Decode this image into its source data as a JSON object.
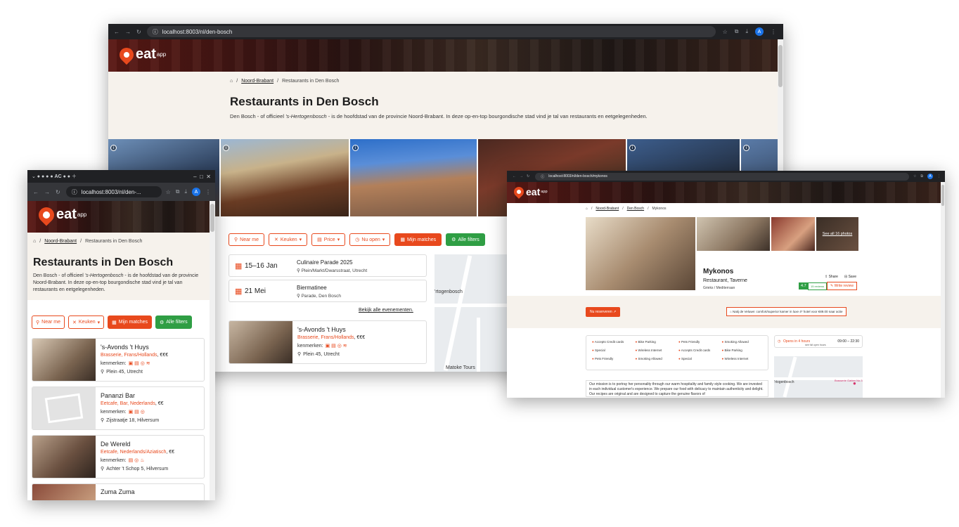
{
  "bg_window": {
    "url": "localhost:8003/nl/den-bosch",
    "logo_text": "eat",
    "logo_sub": "app",
    "breadcrumb": [
      "Noord-Brabant",
      "Restaurants in Den Bosch"
    ],
    "title": "Restaurants in Den Bosch",
    "intro_before": "Den Bosch - of officieel ",
    "intro_em": "'s-Hertogenbosch",
    "intro_after": " - is de hoofdstad van de provincie Noord-Brabant. In deze op-en-top bourgondische stad vind je tal van restaurants en eetgelegenheden.",
    "filters": {
      "near": "Near me",
      "kitchen": "Keuken",
      "price": "Price",
      "open": "Nu open",
      "matches": "Mijn matches",
      "all": "Alle filters"
    },
    "events": [
      {
        "date": "15–16 Jan",
        "name": "Culinaire Parade 2025",
        "place": "Plein/Markt/Dwarsstraat, Utrecht"
      },
      {
        "date": "21 Mei",
        "name": "Biermatinee",
        "place": "Parade, Den Bosch"
      }
    ],
    "events_link": "Bekijk alle evenementen.",
    "restaurant": {
      "name": "'s-Avonds 't Huys",
      "tags": "Brasserie, Frans/Hollands",
      "price": ", €€€",
      "features_label": "kenmerken:",
      "address": "Plein 45, Utrecht"
    },
    "map_labels": [
      "'rtogenbosch",
      "Matoke Tours"
    ]
  },
  "left_window": {
    "url": "localhost:8003/nl/den-...",
    "tab_icons": "AC",
    "logo_text": "eat",
    "logo_sub": "app",
    "breadcrumb": [
      "Noord-Brabant",
      "Restaurants in Den Bosch"
    ],
    "title": "Restaurants in Den Bosch",
    "intro_before": "Den Bosch - of officieel ",
    "intro_em": "'s-Hertogenbosch",
    "intro_after": " - is de hoofdstad van de provincie Noord-Brabant. In deze op-en-top bourgondische stad vind je tal van restaurants en eetgelegenheden.",
    "filters": {
      "near": "Near me",
      "kitchen": "Keuken",
      "matches": "Mijn matches",
      "all": "Alle filters"
    },
    "features_label": "kenmerken:",
    "restaurants": [
      {
        "name": "'s-Avonds 't Huys",
        "tags": "Brasserie, Frans/Hollands",
        "price": ", €€€",
        "address": "Plein 45, Utrecht"
      },
      {
        "name": "Pananzi Bar",
        "tags": "Eetcafe, Bar, Nederlands",
        "price": ", €€",
        "address": "Zijstraatje 18, Hilversum"
      },
      {
        "name": "De Wereld",
        "tags": "Eetcafe, Nederlands/Aziatisch",
        "price": ", €€",
        "address": "Achter 't Schop 5, Hilversum"
      },
      {
        "name": "Zuma Zuma",
        "tags": "",
        "price": "",
        "address": ""
      }
    ]
  },
  "right_window": {
    "url": "localhost:8003/nl/den-bosch/mykonos",
    "logo_text": "eat",
    "logo_sub": "app",
    "breadcrumb": [
      "Noord-Brabant",
      "Den Bosch",
      "Mykonos"
    ],
    "see_all": "See all 16 photos",
    "name": "Mykonos",
    "type": "Restaurant, Taverne",
    "cuisine": "Grieks / Mediterraan",
    "share": "Share",
    "save": "Save",
    "rating": "4.7",
    "reviews": "15 reviews",
    "write_review": "Write review",
    "reserve": "Nu reserveren",
    "promo": "Natij de Veluwe: comfort/superior kamer in luxe 4* hotel voor €89.00 naar actie",
    "amenities": [
      "Accepts Credit cards",
      "Bike Parking",
      "Pets Friendly",
      "Smoking Allowed",
      "Special",
      "Wireless Internet",
      "Accepts Credit cards",
      "Bike Parking",
      "Pets Friendly",
      "Smoking Allowed",
      "Special",
      "Wireless Internet"
    ],
    "open_label": "Opens in 4 hours",
    "open_hours": "09:00 – 22:30",
    "hours_link": "see full open hours",
    "description": "Our mission is to portray her personality through our warm hospitality and family style cooking. We are invested in each individual customer's experience. We prepare our food with delicacy to maintain authenticity and delight. Our recipes are original and are designed to capture the genuine flavors of",
    "map_labels": [
      "'rtogenbosch",
      "Brasserie Gatten No.3"
    ]
  },
  "colors": {
    "accent": "#e8491d",
    "green": "#2f9e44",
    "beige": "#f6f2ec",
    "chrome": "#202124"
  }
}
